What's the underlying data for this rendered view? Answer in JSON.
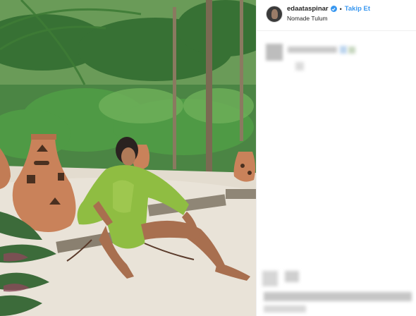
{
  "header": {
    "username": "edaataspinar",
    "follow_label": "Takip Et",
    "separator": "•",
    "location": "Nomade Tulum"
  },
  "icons": {
    "verified": "verified-badge-icon",
    "avatar": "profile-avatar"
  },
  "colors": {
    "link_blue": "#3897f0",
    "text_dark": "#262626",
    "divider": "#efefef"
  }
}
